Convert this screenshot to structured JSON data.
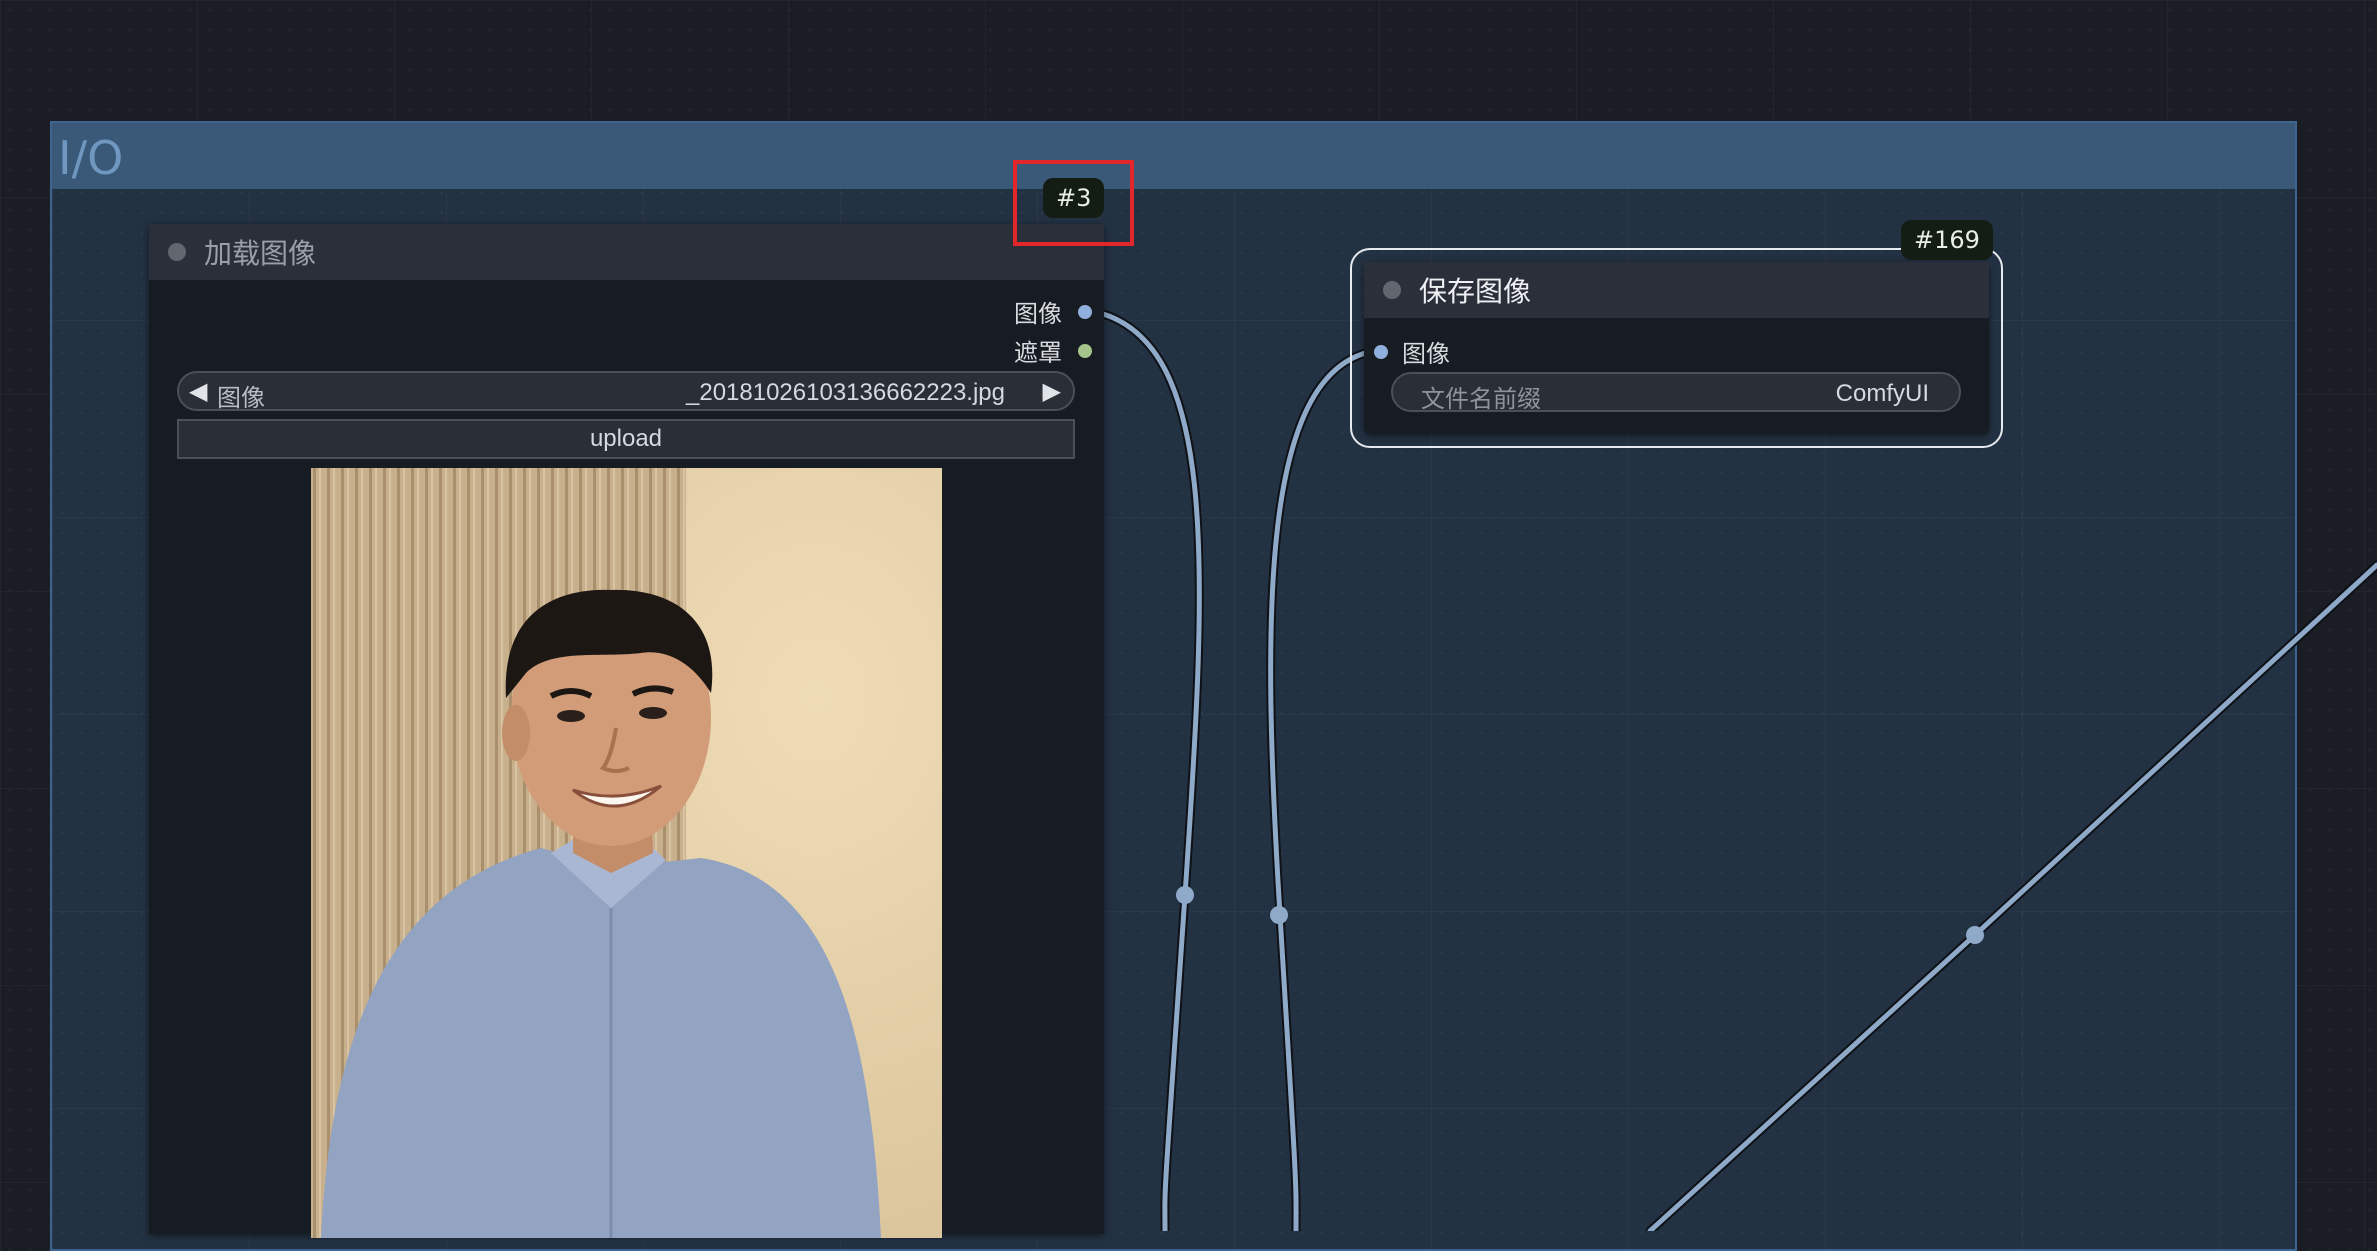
{
  "group": {
    "title": "I/O"
  },
  "load_node": {
    "id": "#3",
    "title": "加载图像",
    "outputs": [
      {
        "label": "图像",
        "color": "#8fb0dd"
      },
      {
        "label": "遮罩",
        "color": "#a6c58c"
      }
    ],
    "image_widget": {
      "label": "图像",
      "value": "_20181026103136662223.jpg",
      "left_arrow": "◀",
      "right_arrow": "▶"
    },
    "upload_label": "upload"
  },
  "save_node": {
    "id": "#169",
    "title": "保存图像",
    "input": {
      "label": "图像",
      "color": "#8fb0dd"
    },
    "filename_widget": {
      "label": "文件名前缀",
      "value": "ComfyUI"
    }
  },
  "colors": {
    "link": "#8fa9c8",
    "highlight_box": "#e3262a",
    "group_border": "#3e6591"
  }
}
